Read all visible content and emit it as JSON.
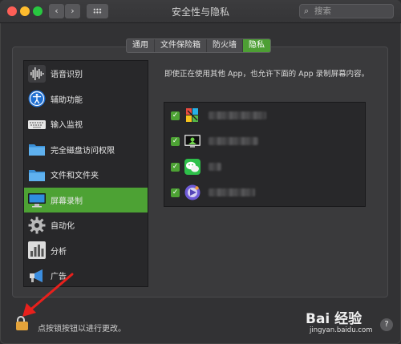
{
  "window": {
    "title": "安全性与隐私",
    "nav": {
      "back_glyph": "‹",
      "forward_glyph": "›"
    },
    "search": {
      "placeholder": "搜索",
      "icon": "search-icon"
    }
  },
  "tabs": [
    {
      "label": "通用",
      "active": false
    },
    {
      "label": "文件保险箱",
      "active": false
    },
    {
      "label": "防火墙",
      "active": false
    },
    {
      "label": "隐私",
      "active": true
    }
  ],
  "sidebar": {
    "items": [
      {
        "label": "语音识别",
        "icon": "waveform-icon",
        "selected": false
      },
      {
        "label": "辅助功能",
        "icon": "accessibility-icon",
        "selected": false
      },
      {
        "label": "输入监视",
        "icon": "keyboard-icon",
        "selected": false
      },
      {
        "label": "完全磁盘访问权限",
        "icon": "folder-icon",
        "selected": false
      },
      {
        "label": "文件和文件夹",
        "icon": "folder-icon",
        "selected": false
      },
      {
        "label": "屏幕录制",
        "icon": "display-icon",
        "selected": true
      },
      {
        "label": "自动化",
        "icon": "gear-icon",
        "selected": false
      },
      {
        "label": "分析",
        "icon": "chart-icon",
        "selected": false
      },
      {
        "label": "广告",
        "icon": "megaphone-icon",
        "selected": false
      }
    ]
  },
  "main": {
    "description": "即使正在使用其他 App，也允许下面的 App 录制屏幕内容。",
    "apps": [
      {
        "checked": true,
        "icon": "colorful-app-icon",
        "name_redacted": true
      },
      {
        "checked": true,
        "icon": "screen-recorder-app-icon",
        "name_redacted": true
      },
      {
        "checked": true,
        "icon": "wechat-icon",
        "name_redacted": true
      },
      {
        "checked": true,
        "icon": "media-app-icon",
        "name_redacted": true
      }
    ],
    "check_glyph": "✓"
  },
  "footer": {
    "lock_text": "点按锁按钮以进行更改。",
    "lock_icon": "lock-icon",
    "help_label": "?"
  },
  "watermark": {
    "logo": "Bai 经验",
    "url": "jingyan.baidu.com"
  },
  "colors": {
    "accent": "#4da234",
    "lock": "#e3a23a",
    "annotation_arrow": "#e8201c"
  }
}
